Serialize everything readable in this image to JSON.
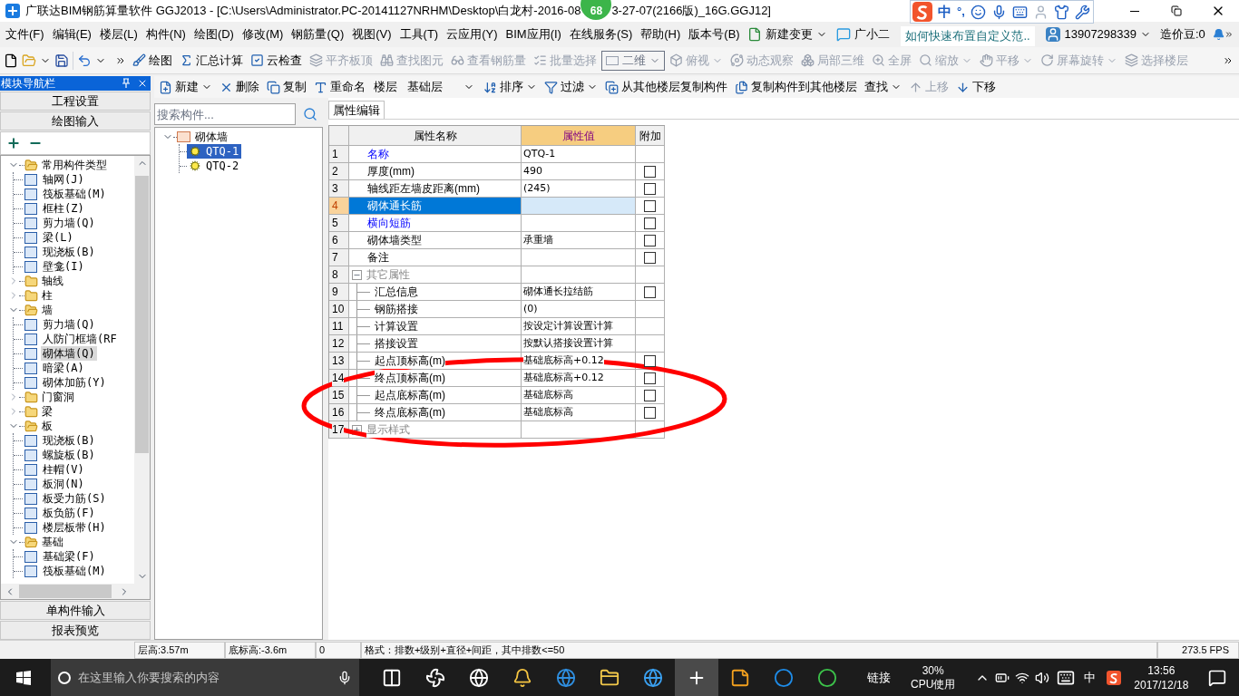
{
  "window": {
    "title_start": "广联达BIM钢筋算量软件 GGJ2013 - [C:\\Users\\Administrator.PC-20141127NRHM\\Desktop\\白龙村-2016-08",
    "title_end": "3-27-07(2166版)_16G.GGJ12]",
    "badge": "68"
  },
  "ime_bar": {
    "mode": "中",
    "punct": "°,"
  },
  "menu": [
    "文件(F)",
    "编辑(E)",
    "楼层(L)",
    "构件(N)",
    "绘图(D)",
    "修改(M)",
    "钢筋量(Q)",
    "视图(V)",
    "工具(T)",
    "云应用(Y)",
    "BIM应用(I)",
    "在线服务(S)",
    "帮助(H)",
    "版本号(B)"
  ],
  "menu_right": {
    "change": "新建变更",
    "assistant": "广小二",
    "news": "如何快速布置自定义范..",
    "account": "13907298339",
    "beans": "造价豆:0"
  },
  "toolbar": [
    {
      "kind": "button",
      "label": "绘图",
      "disabled": false
    },
    {
      "kind": "button",
      "label": "汇总计算",
      "disabled": false
    },
    {
      "kind": "button",
      "label": "云检查",
      "disabled": false
    },
    {
      "kind": "button",
      "label": "平齐板顶",
      "disabled": true
    },
    {
      "kind": "button",
      "label": "查找图元",
      "disabled": true
    },
    {
      "kind": "button",
      "label": "查看钢筋量",
      "disabled": true
    },
    {
      "kind": "button",
      "label": "批量选择",
      "disabled": true
    },
    {
      "kind": "select",
      "label": "二维",
      "disabled": true
    },
    {
      "kind": "button",
      "label": "俯视",
      "disabled": true,
      "dropdown": true
    },
    {
      "kind": "button",
      "label": "动态观察",
      "disabled": true
    },
    {
      "kind": "button",
      "label": "局部三维",
      "disabled": true
    },
    {
      "kind": "button",
      "label": "全屏",
      "disabled": true
    },
    {
      "kind": "button",
      "label": "缩放",
      "disabled": true,
      "dropdown": true
    },
    {
      "kind": "button",
      "label": "平移",
      "disabled": true,
      "dropdown": true
    },
    {
      "kind": "button",
      "label": "屏幕旋转",
      "disabled": true,
      "dropdown": true
    },
    {
      "kind": "button",
      "label": "选择楼层",
      "disabled": true
    }
  ],
  "nav_panel": {
    "title": "模块导航栏",
    "top_buttons": [
      "工程设置",
      "绘图输入"
    ],
    "bottom_buttons": [
      "单构件输入",
      "报表预览"
    ]
  },
  "nav_tree": [
    {
      "label": "常用构件类型",
      "expanded": true,
      "children": [
        {
          "label": "轴网(J)",
          "selected": false
        },
        {
          "label": "筏板基础(M)",
          "selected": false
        },
        {
          "label": "框柱(Z)",
          "selected": false
        },
        {
          "label": "剪力墙(Q)",
          "selected": false
        },
        {
          "label": "梁(L)",
          "selected": false
        },
        {
          "label": "现浇板(B)",
          "selected": false
        },
        {
          "label": "壁龛(I)",
          "selected": false
        }
      ]
    },
    {
      "label": "轴线",
      "expanded": false
    },
    {
      "label": "柱",
      "expanded": false
    },
    {
      "label": "墙",
      "expanded": true,
      "children": [
        {
          "label": "剪力墙(Q)",
          "selected": false
        },
        {
          "label": "人防门框墙(RF",
          "selected": false
        },
        {
          "label": "砌体墙(Q)",
          "selected": true
        },
        {
          "label": "暗梁(A)",
          "selected": false
        },
        {
          "label": "砌体加筋(Y)",
          "selected": false
        }
      ]
    },
    {
      "label": "门窗洞",
      "expanded": false
    },
    {
      "label": "梁",
      "expanded": false
    },
    {
      "label": "板",
      "expanded": true,
      "children": [
        {
          "label": "现浇板(B)",
          "selected": false
        },
        {
          "label": "螺旋板(B)",
          "selected": false
        },
        {
          "label": "柱帽(V)",
          "selected": false
        },
        {
          "label": "板洞(N)",
          "selected": false
        },
        {
          "label": "板受力筋(S)",
          "selected": false
        },
        {
          "label": "板负筋(F)",
          "selected": false
        },
        {
          "label": "楼层板带(H)",
          "selected": false
        }
      ]
    },
    {
      "label": "基础",
      "expanded": true,
      "children": [
        {
          "label": "基础梁(F)",
          "selected": false
        },
        {
          "label": "筏板基础(M)",
          "selected": false
        }
      ]
    }
  ],
  "component_toolbar": [
    {
      "kind": "button",
      "label": "新建",
      "dropdown": true,
      "disabled": false
    },
    {
      "kind": "button",
      "label": "删除",
      "disabled": false
    },
    {
      "kind": "button",
      "label": "复制",
      "disabled": false
    },
    {
      "kind": "button",
      "label": "重命名",
      "disabled": false
    },
    {
      "kind": "label",
      "label": "楼层"
    },
    {
      "kind": "select",
      "label": "基础层"
    },
    {
      "kind": "button",
      "label": "排序",
      "dropdown": true,
      "disabled": false
    },
    {
      "kind": "button",
      "label": "过滤",
      "dropdown": true,
      "disabled": false
    },
    {
      "kind": "button",
      "label": "从其他楼层复制构件",
      "disabled": false
    },
    {
      "kind": "button",
      "label": "复制构件到其他楼层",
      "disabled": false
    },
    {
      "kind": "button",
      "label": "查找",
      "dropdown": true,
      "disabled": false
    },
    {
      "kind": "button",
      "label": "上移",
      "disabled": true
    },
    {
      "kind": "button",
      "label": "下移",
      "disabled": false
    }
  ],
  "component_search": {
    "placeholder": "搜索构件..."
  },
  "component_tree": {
    "label": "砌体墙",
    "expanded": true,
    "children": [
      {
        "label": "QTQ-1",
        "selected": true
      },
      {
        "label": "QTQ-2",
        "selected": false
      }
    ]
  },
  "property_tab": {
    "label": "属性编辑",
    "selected": true
  },
  "property_table": {
    "columns": [
      "属性名称",
      "属性值",
      "附加"
    ],
    "rows": [
      {
        "num": "1",
        "kind": "property",
        "name": "名称",
        "value": "QTQ-1",
        "public": true,
        "selected": false
      },
      {
        "num": "2",
        "kind": "property",
        "name": "厚度(mm)",
        "value": "490",
        "public": false,
        "selected": false,
        "extra": {
          "checked": false
        }
      },
      {
        "num": "3",
        "kind": "property",
        "name": "轴线距左墙皮距离(mm)",
        "value": "(245)",
        "public": false,
        "selected": false,
        "extra": {
          "checked": false
        }
      },
      {
        "num": "4",
        "kind": "property",
        "name": "砌体通长筋",
        "public": true,
        "selected": true,
        "extra": {
          "checked": false
        }
      },
      {
        "num": "5",
        "kind": "property",
        "name": "横向短筋",
        "public": true,
        "selected": false,
        "extra": {
          "checked": false
        }
      },
      {
        "num": "6",
        "kind": "property",
        "name": "砌体墙类型",
        "value": "承重墙",
        "public": false,
        "selected": false,
        "extra": {
          "checked": false
        }
      },
      {
        "num": "7",
        "kind": "property",
        "name": "备注",
        "public": false,
        "selected": false,
        "extra": {
          "checked": false
        }
      },
      {
        "num": "8",
        "kind": "group",
        "name": "其它属性",
        "expanded": true,
        "selected": false
      },
      {
        "num": "9",
        "kind": "child",
        "name": "汇总信息",
        "value": "砌体通长拉结筋",
        "selected": false,
        "extra": {
          "checked": false
        }
      },
      {
        "num": "10",
        "kind": "child",
        "name": "钢筋搭接",
        "value": "(0)",
        "selected": false
      },
      {
        "num": "11",
        "kind": "child",
        "name": "计算设置",
        "value": "按设定计算设置计算",
        "selected": false
      },
      {
        "num": "12",
        "kind": "child",
        "name": "搭接设置",
        "value": "按默认搭接设置计算",
        "selected": false
      },
      {
        "num": "13",
        "kind": "child",
        "name": "起点顶标高(m)",
        "value": "基础底标高+0.12",
        "selected": false,
        "extra": {
          "checked": false
        }
      },
      {
        "num": "14",
        "kind": "child",
        "name": "终点顶标高(m)",
        "value": "基础底标高+0.12",
        "selected": false,
        "extra": {
          "checked": false
        }
      },
      {
        "num": "15",
        "kind": "child",
        "name": "起点底标高(m)",
        "value": "基础底标高",
        "selected": false,
        "extra": {
          "checked": false
        }
      },
      {
        "num": "16",
        "kind": "child",
        "name": "终点底标高(m)",
        "value": "基础底标高",
        "selected": false,
        "extra": {
          "checked": false
        }
      },
      {
        "num": "17",
        "kind": "group",
        "name": "显示样式",
        "expanded": false,
        "selected": false
      }
    ]
  },
  "status_bar": [
    "层高:3.57m",
    "底标高:-3.6m",
    "0",
    "格式：排数+级别+直径+间距，其中排数<=50",
    "273.5 FPS"
  ],
  "taskbar": {
    "search_placeholder": "在这里输入你要搜索的内容",
    "apps": [
      {
        "selected": false
      },
      {
        "selected": false
      },
      {
        "selected": false
      },
      {
        "selected": false
      },
      {
        "selected": false
      },
      {
        "selected": false
      },
      {
        "selected": false
      },
      {
        "selected": true
      },
      {
        "selected": false
      },
      {
        "selected": false
      },
      {
        "selected": false
      }
    ],
    "links": "链接",
    "cpu_value": "30%",
    "cpu_label": "CPU使用",
    "ime": "中",
    "time": "13:56",
    "date": "2017/12/18"
  }
}
